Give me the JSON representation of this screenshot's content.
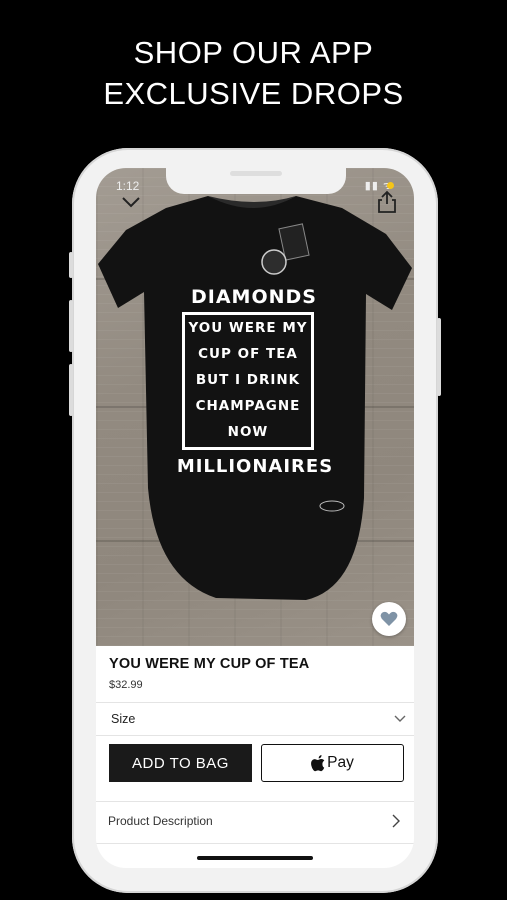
{
  "headline": {
    "line1": "SHOP OUR APP",
    "line2": "EXCLUSIVE DROPS"
  },
  "status_bar": {
    "time": "1:12",
    "indicators": "▮▮ ᯤ"
  },
  "product_image": {
    "shirt_print": {
      "top": "DIAMONDS",
      "lines": [
        "YOU WERE MY",
        "CUP OF TEA",
        "BUT I DRINK",
        "CHAMPAGNE",
        "NOW"
      ],
      "bottom": "MILLIONAIRES"
    }
  },
  "product": {
    "title": "YOU WERE MY CUP OF TEA",
    "price": "$32.99"
  },
  "size_selector": {
    "label": "Size"
  },
  "actions": {
    "add_to_bag": "ADD TO BAG",
    "apple_pay": "Pay"
  },
  "description": {
    "label": "Product Description"
  },
  "colors": {
    "background": "#000000",
    "phone_frame": "#f2f2f2",
    "button_dark": "#1a1a1a",
    "favorite_icon": "#7f93a6"
  },
  "icons": [
    "chevron-down-icon",
    "share-icon",
    "heart-icon",
    "apple-logo-icon",
    "chevron-right-icon"
  ]
}
